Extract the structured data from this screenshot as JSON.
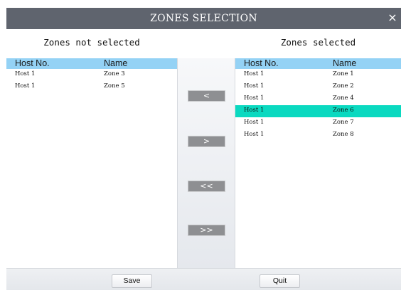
{
  "dialog": {
    "title": "ZONES SELECTION",
    "close_icon": "close-icon",
    "close_glyph": "×"
  },
  "left_panel": {
    "heading": "Zones not selected",
    "columns": [
      "Host No.",
      "Name"
    ],
    "rows": [
      {
        "host": "Host 1",
        "name": "Zone 3"
      },
      {
        "host": "Host 1",
        "name": "Zone 5"
      }
    ]
  },
  "right_panel": {
    "heading": "Zones selected",
    "columns": [
      "Host No.",
      "Name"
    ],
    "rows": [
      {
        "host": "Host 1",
        "name": "Zone 1"
      },
      {
        "host": "Host 1",
        "name": "Zone 2"
      },
      {
        "host": "Host 1",
        "name": "Zone 4"
      },
      {
        "host": "Host 1",
        "name": "Zone 6"
      },
      {
        "host": "Host 1",
        "name": "Zone 7"
      },
      {
        "host": "Host 1",
        "name": "Zone 8"
      }
    ],
    "selected_row": 3
  },
  "transfer_buttons": {
    "move_left": "<",
    "move_right": ">",
    "move_all_left": "<<",
    "move_all_right": ">>"
  },
  "footer": {
    "save_label": "Save",
    "quit_label": "Quit"
  },
  "colors": {
    "titlebar": "#5f646e",
    "table_header": "#94d2f5",
    "selected_row": "#0ad9c0",
    "transfer_button": "#8e8f92"
  }
}
